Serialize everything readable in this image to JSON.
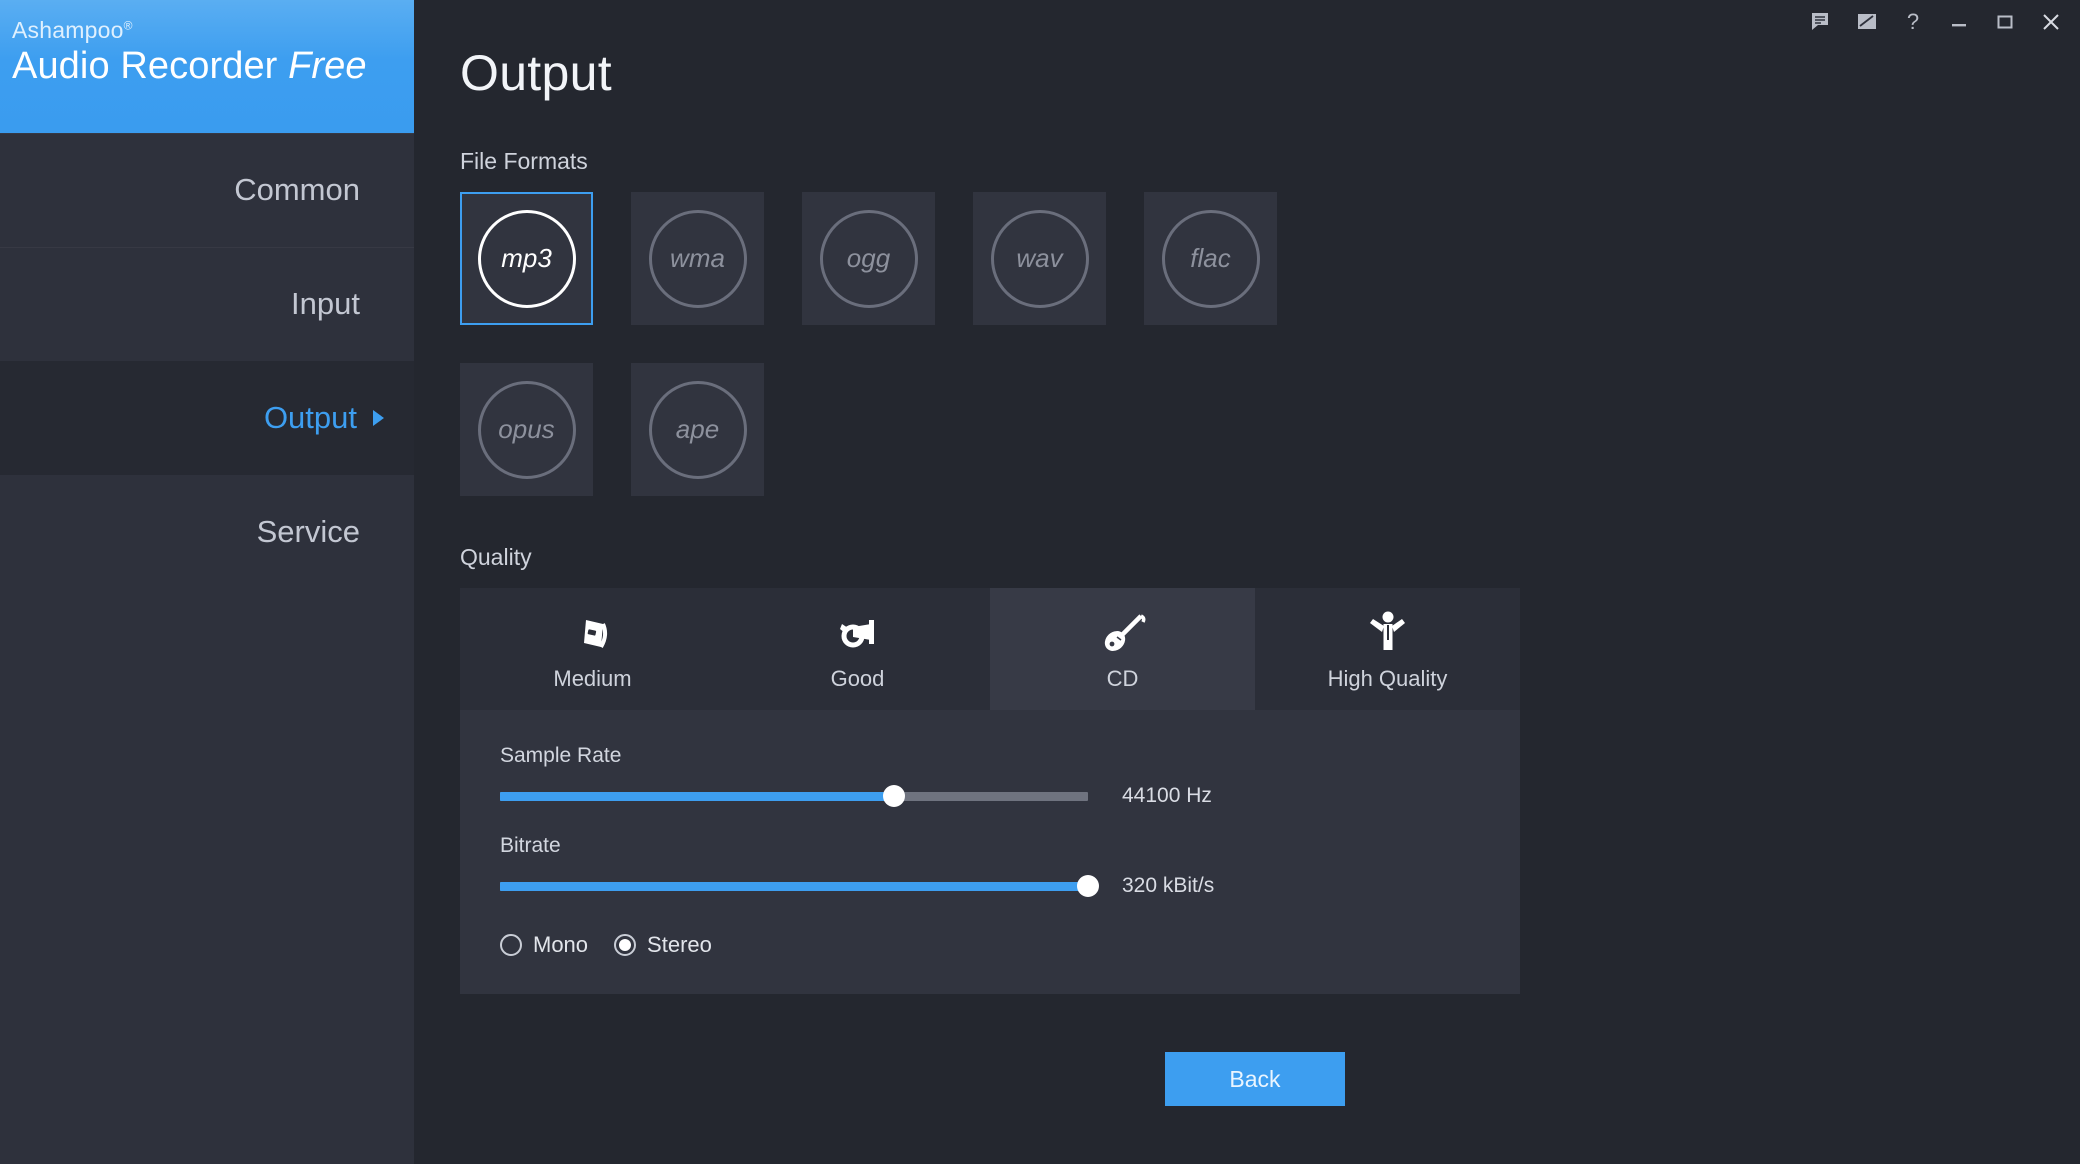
{
  "titlebar": {
    "buttons": [
      {
        "name": "feedback-icon",
        "label": "Feedback"
      },
      {
        "name": "notes-icon",
        "label": "Notes"
      },
      {
        "name": "help-icon",
        "label": "?"
      },
      {
        "name": "minimize-icon",
        "label": "Minimize"
      },
      {
        "name": "maximize-icon",
        "label": "Maximize"
      },
      {
        "name": "close-icon",
        "label": "Close"
      }
    ]
  },
  "brand": {
    "company": "Ashampoo",
    "trademark": "®",
    "product": "Audio Recorder ",
    "edition": "Free"
  },
  "sidebar": {
    "items": [
      {
        "label": "Common",
        "active": false
      },
      {
        "label": "Input",
        "active": false
      },
      {
        "label": "Output",
        "active": true
      },
      {
        "label": "Service",
        "active": false
      }
    ]
  },
  "main": {
    "title": "Output",
    "file_formats_label": "File Formats",
    "quality_label": "Quality",
    "formats": [
      {
        "label": "mp3",
        "selected": true
      },
      {
        "label": "wma",
        "selected": false
      },
      {
        "label": "ogg",
        "selected": false
      },
      {
        "label": "wav",
        "selected": false
      },
      {
        "label": "flac",
        "selected": false
      },
      {
        "label": "opus",
        "selected": false
      },
      {
        "label": "ape",
        "selected": false
      }
    ],
    "quality_tabs": [
      {
        "label": "Medium",
        "icon": "radio-icon",
        "active": false
      },
      {
        "label": "Good",
        "icon": "trumpet-icon",
        "active": false
      },
      {
        "label": "CD",
        "icon": "guitar-icon",
        "active": true
      },
      {
        "label": "High Quality",
        "icon": "conductor-icon",
        "active": false
      }
    ],
    "sliders": [
      {
        "label": "Sample Rate",
        "value": "44100 Hz",
        "percent": 67
      },
      {
        "label": "Bitrate",
        "value": "320 kBit/s",
        "percent": 100
      }
    ],
    "channels": [
      {
        "label": "Mono",
        "checked": false
      },
      {
        "label": "Stereo",
        "checked": true
      }
    ]
  },
  "footer": {
    "back_label": "Back"
  },
  "colors": {
    "accent": "#3d9ef0",
    "window_bg": "#24272f",
    "sidebar_bg": "#2e313c",
    "panel_bg": "#31343f",
    "tab_bg": "#2b2e38",
    "tab_active_bg": "#373a46",
    "text": "#e2e5eb",
    "text_dim": "#8d919d"
  }
}
